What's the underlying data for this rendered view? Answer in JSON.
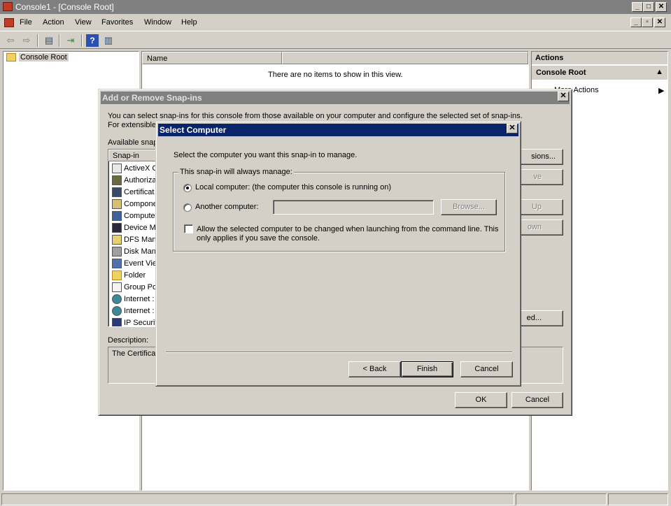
{
  "main_window": {
    "title": "Console1 - [Console Root]",
    "menu": [
      "File",
      "Action",
      "View",
      "Favorites",
      "Window",
      "Help"
    ],
    "tree": {
      "root": "Console Root"
    },
    "list": {
      "column_name": "Name",
      "empty_message": "There are no items to show in this view."
    },
    "actions": {
      "header": "Actions",
      "section": "Console Root",
      "more_actions": "More Actions"
    }
  },
  "snapins_dialog": {
    "title": "Add or Remove Snap-ins",
    "intro": "You can select snap-ins for this console from those available on your computer and configure the selected set of snap-ins. For extensible sna",
    "available_label": "Available snap",
    "column_snapin": "Snap-in",
    "snapins": [
      {
        "name": "ActiveX C",
        "icon": "activex-icon"
      },
      {
        "name": "Authoriza",
        "icon": "authorization-icon"
      },
      {
        "name": "Certificat",
        "icon": "certificates-icon"
      },
      {
        "name": "Compone",
        "icon": "component-services-icon"
      },
      {
        "name": "Computer",
        "icon": "computer-management-icon"
      },
      {
        "name": "Device Ma",
        "icon": "device-manager-icon"
      },
      {
        "name": "DFS Mana",
        "icon": "dfs-icon"
      },
      {
        "name": "Disk Mana",
        "icon": "disk-management-icon"
      },
      {
        "name": "Event Vie",
        "icon": "event-viewer-icon"
      },
      {
        "name": "Folder",
        "icon": "folder-icon"
      },
      {
        "name": "Group Po",
        "icon": "group-policy-icon"
      },
      {
        "name": "Internet :",
        "icon": "internet-icon"
      },
      {
        "name": "Internet :",
        "icon": "internet-icon"
      },
      {
        "name": "IP Securit",
        "icon": "ip-security-icon"
      }
    ],
    "description_label": "Description:",
    "description_text": "The Certificat",
    "side_buttons": [
      "sions...",
      "ve",
      "Up",
      "own",
      "ed..."
    ],
    "ok": "OK",
    "cancel": "Cancel"
  },
  "select_computer_dialog": {
    "title": "Select Computer",
    "prompt": "Select the computer you want this snap-in to manage.",
    "group_label": "This snap-in will always manage:",
    "local_option": "Local computer:  (the computer this console is running on)",
    "another_option": "Another computer:",
    "another_value": "",
    "browse": "Browse...",
    "allow_change_line1": "Allow the selected computer to be changed when launching from the command line.  This",
    "allow_change_line2": "only applies if you save the console.",
    "back": "< Back",
    "finish": "Finish",
    "cancel": "Cancel"
  },
  "colors": {
    "active_title": "#0a246a",
    "inactive_title": "#808080",
    "face": "#d4d0c8"
  }
}
